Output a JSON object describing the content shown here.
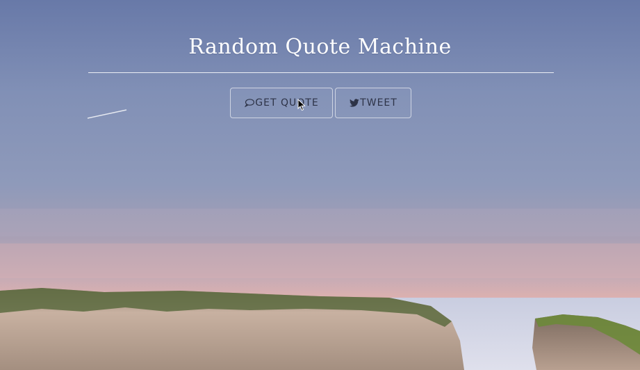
{
  "app": {
    "title": "Random Quote Machine"
  },
  "buttons": {
    "get_quote": {
      "label": "GET QUOTE",
      "icon": "speech-bubble-icon"
    },
    "tweet": {
      "label": "TWEET",
      "icon": "twitter-bird-icon"
    }
  },
  "colors": {
    "sky_top": "#6f7ea8",
    "sky_mid": "#8c96b5",
    "sunset": "#e9b3a0",
    "sea": "#cfd3e3",
    "cliff": "#b9a08d",
    "grass": "#5b6a3b",
    "text_button": "#2d3347",
    "title": "#ffffff"
  }
}
